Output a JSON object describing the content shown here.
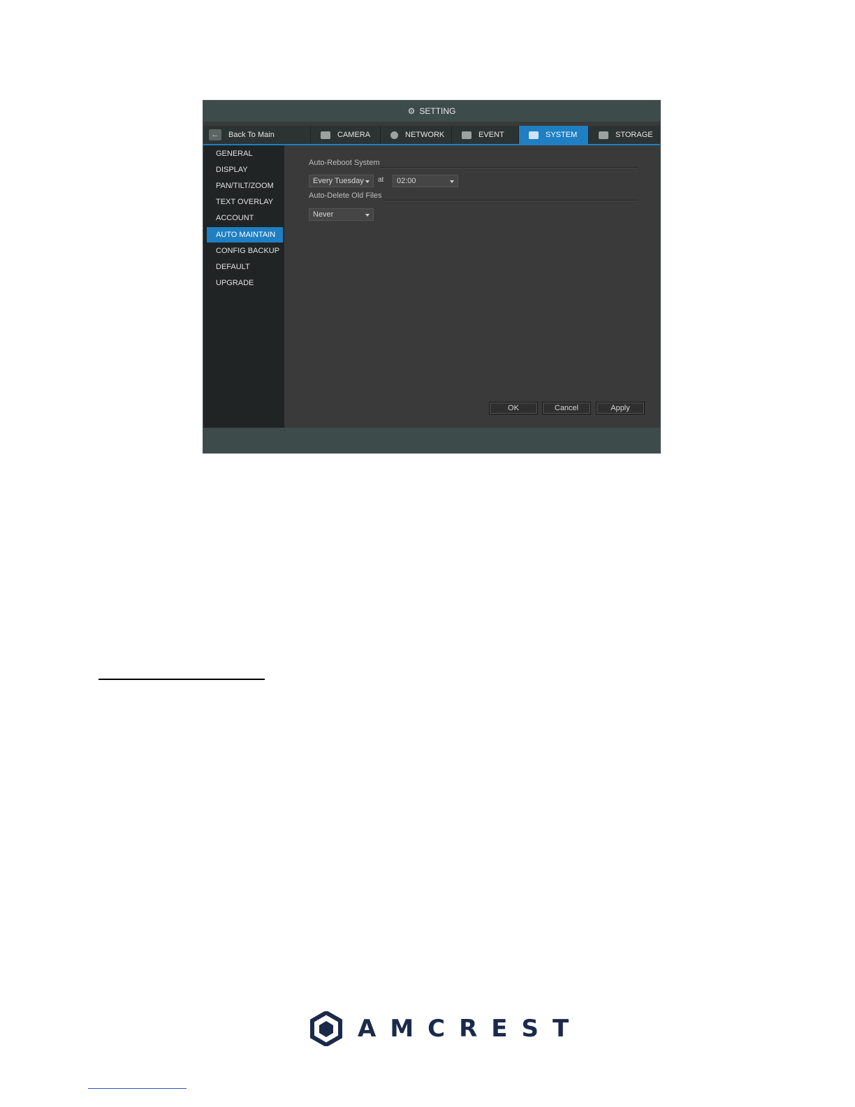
{
  "window": {
    "title": "SETTING"
  },
  "nav": {
    "back_label": "Back To Main",
    "tabs": [
      {
        "label": "CAMERA",
        "icon": "camera-icon"
      },
      {
        "label": "NETWORK",
        "icon": "network-icon"
      },
      {
        "label": "EVENT",
        "icon": "event-icon"
      },
      {
        "label": "SYSTEM",
        "icon": "system-icon",
        "active": true
      },
      {
        "label": "STORAGE",
        "icon": "storage-icon"
      }
    ]
  },
  "sidebar": {
    "items": [
      {
        "label": "GENERAL"
      },
      {
        "label": "DISPLAY"
      },
      {
        "label": "PAN/TILT/ZOOM"
      },
      {
        "label": "TEXT OVERLAY"
      },
      {
        "label": "ACCOUNT"
      },
      {
        "label": "AUTO MAINTAIN",
        "active": true
      },
      {
        "label": "CONFIG BACKUP"
      },
      {
        "label": "DEFAULT"
      },
      {
        "label": "UPGRADE"
      }
    ]
  },
  "auto_reboot": {
    "title": "Auto-Reboot System",
    "day_value": "Every Tuesday",
    "at_label": "at",
    "time_value": "02:00"
  },
  "auto_delete": {
    "title": "Auto-Delete Old Files",
    "value": "Never"
  },
  "buttons": {
    "ok": "OK",
    "cancel": "Cancel",
    "apply": "Apply"
  },
  "brand": {
    "name": "AMCREST",
    "color": "#1b2a4a"
  },
  "colors": {
    "accent": "#1e7fc2"
  }
}
